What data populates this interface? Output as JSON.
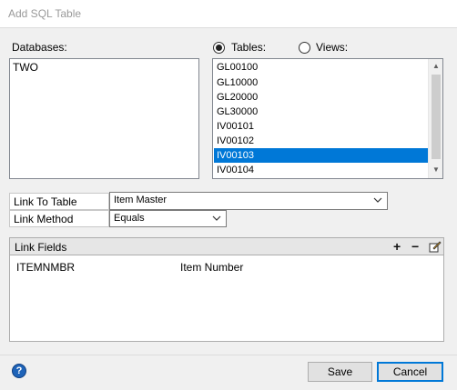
{
  "window": {
    "title": "Add SQL Table"
  },
  "databases": {
    "label": "Databases:",
    "items": [
      "TWO"
    ]
  },
  "source_type": {
    "tables_label": "Tables:",
    "views_label": "Views:",
    "selected": "tables"
  },
  "tables": {
    "items": [
      "GL00100",
      "GL10000",
      "GL20000",
      "GL30000",
      "IV00101",
      "IV00102",
      "IV00103",
      "IV00104"
    ],
    "selected": "IV00103"
  },
  "link_to_table": {
    "label": "Link To Table",
    "value": "Item Master"
  },
  "link_method": {
    "label": "Link Method",
    "value": "Equals"
  },
  "link_fields": {
    "title": "Link Fields",
    "rows": [
      {
        "field": "ITEMNMBR",
        "description": "Item Number"
      }
    ]
  },
  "buttons": {
    "save": "Save",
    "cancel": "Cancel"
  },
  "help": {
    "glyph": "?"
  },
  "colors": {
    "selection": "#0078d7",
    "help_icon": "#1e63b8"
  }
}
